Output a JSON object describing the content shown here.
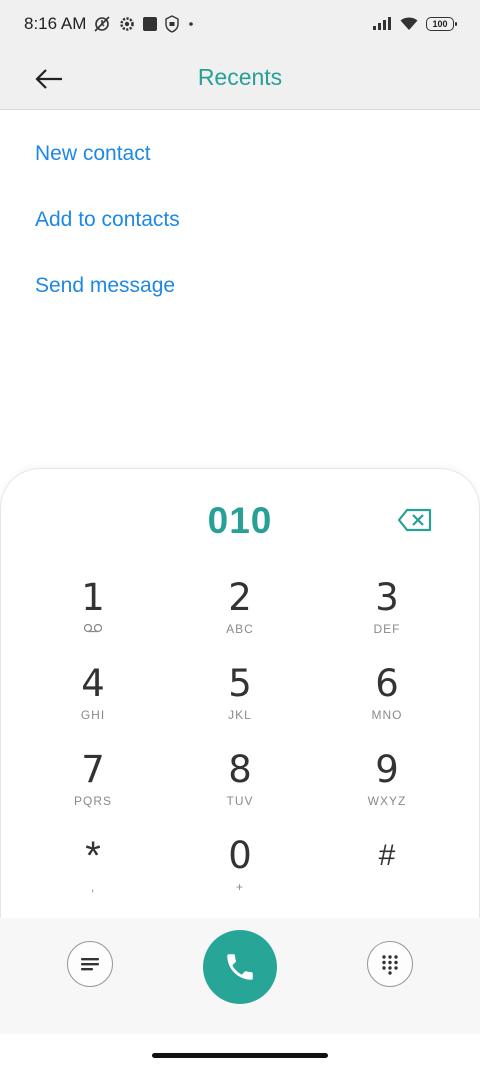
{
  "status_bar": {
    "time": "8:16 AM",
    "battery": "100",
    "icons_left": [
      "alarm-off-icon",
      "settings-icon",
      "square-icon",
      "shield-icon",
      "dot-icon"
    ],
    "icons_right": [
      "signal-icon",
      "wifi-icon",
      "battery-icon"
    ]
  },
  "app_bar": {
    "title": "Recents",
    "back_icon": "back-arrow-icon"
  },
  "actions": {
    "new_contact": "New contact",
    "add_to_contacts": "Add to contacts",
    "send_message": "Send message"
  },
  "dialer": {
    "number": "010",
    "backspace_icon": "backspace-icon",
    "keys": [
      {
        "digit": "1",
        "letters": "",
        "sub_icon": "voicemail-icon"
      },
      {
        "digit": "2",
        "letters": "ABC"
      },
      {
        "digit": "3",
        "letters": "DEF"
      },
      {
        "digit": "4",
        "letters": "GHI"
      },
      {
        "digit": "5",
        "letters": "JKL"
      },
      {
        "digit": "6",
        "letters": "MNO"
      },
      {
        "digit": "7",
        "letters": "PQRS"
      },
      {
        "digit": "8",
        "letters": "TUV"
      },
      {
        "digit": "9",
        "letters": "WXYZ"
      },
      {
        "digit": "*",
        "letters": ","
      },
      {
        "digit": "0",
        "letters": "+"
      },
      {
        "digit": "#",
        "letters": ""
      }
    ]
  },
  "bottom_bar": {
    "menu_icon": "menu-icon",
    "call_icon": "phone-icon",
    "keypad_icon": "dialpad-icon"
  },
  "colors": {
    "accent": "#27a096",
    "link": "#1e88e5",
    "call_button": "#27a596"
  }
}
